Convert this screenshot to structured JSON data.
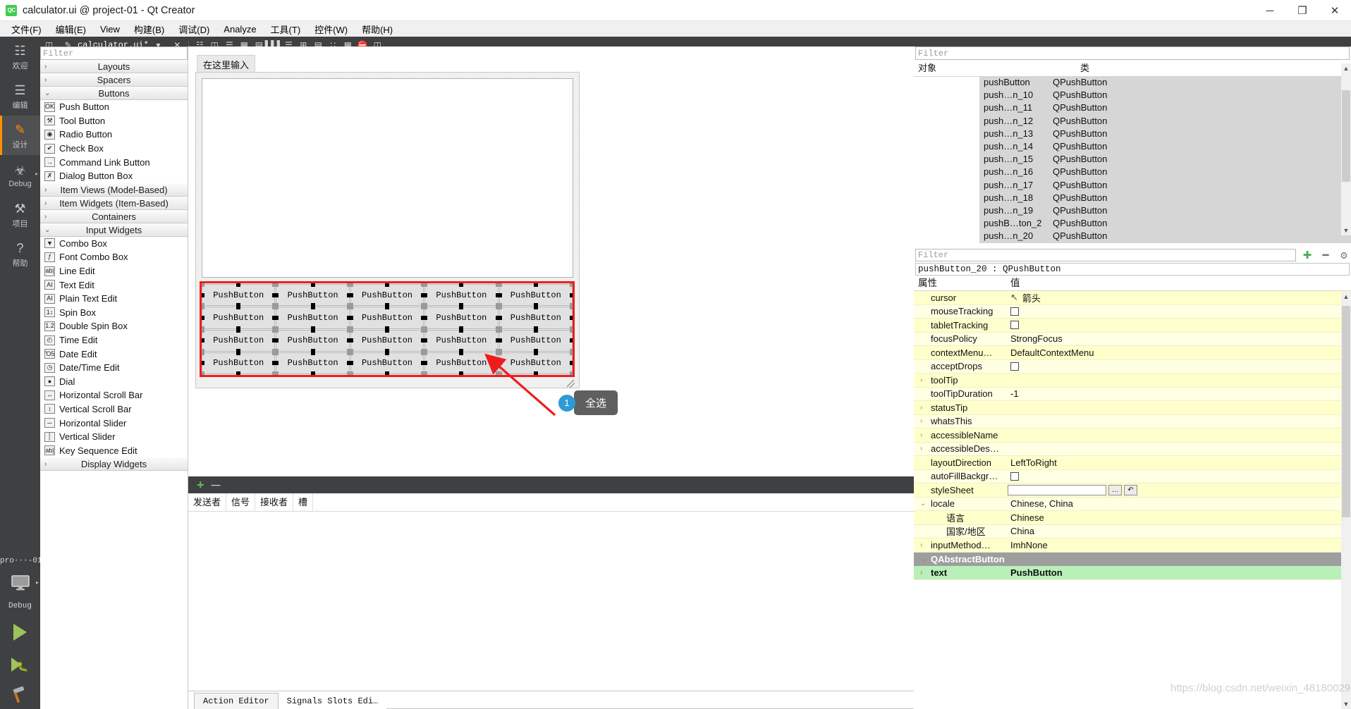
{
  "window": {
    "title": "calculator.ui @ project-01 - Qt Creator",
    "logo_text": "QC",
    "minimize": "─",
    "maximize": "❐",
    "close": "✕"
  },
  "menubar": {
    "items": [
      "文件(F)",
      "编辑(E)",
      "View",
      "构建(B)",
      "调试(D)",
      "Analyze",
      "工具(T)",
      "控件(W)",
      "帮助(H)"
    ]
  },
  "modebar": {
    "items": [
      {
        "label": "欢迎",
        "icon": "grid-icon",
        "glyph": "☷",
        "active": false
      },
      {
        "label": "编辑",
        "icon": "document-icon",
        "glyph": "☰",
        "active": false
      },
      {
        "label": "设计",
        "icon": "pencil-icon",
        "glyph": "✎",
        "active": true
      },
      {
        "label": "Debug",
        "icon": "bug-icon",
        "glyph": "☣",
        "active": false,
        "arrow": "▸"
      },
      {
        "label": "项目",
        "icon": "wrench-icon",
        "glyph": "⚒",
        "active": false
      },
      {
        "label": "帮助",
        "icon": "question-icon",
        "glyph": "?",
        "active": false
      }
    ],
    "bottom": {
      "project": "pro···-01",
      "kit_icon": "monitor-icon",
      "kit_label": "Debug",
      "run_icon": "run-icon",
      "debug_icon": "debug-run-icon",
      "build_icon": "hammer-icon"
    }
  },
  "edtoolbar": {
    "file_name": "calculator.ui*",
    "icons": [
      "split-icon",
      "edit-file-icon",
      "dropdown-icon",
      "close-file-icon",
      "adjust-size-icon",
      "lay-horizontally-icon",
      "lay-vertically-icon",
      "lay-grid-icon",
      "break-layout-icon",
      "lay-splitter-h-icon",
      "lay-splitter-v-icon",
      "lay-form-icon",
      "tab-order-icon",
      "buddy-icon",
      "signal-slot-icon",
      "preview-icon"
    ]
  },
  "widgetbox": {
    "filter_placeholder": "Filter",
    "categories": [
      {
        "name": "Layouts",
        "expanded": false,
        "items": []
      },
      {
        "name": "Spacers",
        "expanded": false,
        "items": []
      },
      {
        "name": "Buttons",
        "expanded": true,
        "items": [
          {
            "label": "Push Button",
            "icon": "push-button-icon",
            "glyph": "OK"
          },
          {
            "label": "Tool Button",
            "icon": "tool-button-icon",
            "glyph": "⚒"
          },
          {
            "label": "Radio Button",
            "icon": "radio-button-icon",
            "glyph": "◉"
          },
          {
            "label": "Check Box",
            "icon": "check-box-icon",
            "glyph": "✔"
          },
          {
            "label": "Command Link Button",
            "icon": "command-link-icon",
            "glyph": "→"
          },
          {
            "label": "Dialog Button Box",
            "icon": "dialog-button-box-icon",
            "glyph": "✗"
          }
        ]
      },
      {
        "name": "Item Views (Model-Based)",
        "expanded": false,
        "items": []
      },
      {
        "name": "Item Widgets (Item-Based)",
        "expanded": false,
        "items": []
      },
      {
        "name": "Containers",
        "expanded": false,
        "items": []
      },
      {
        "name": "Input Widgets",
        "expanded": true,
        "items": [
          {
            "label": "Combo Box",
            "icon": "combo-box-icon",
            "glyph": "▼"
          },
          {
            "label": "Font Combo Box",
            "icon": "font-combo-box-icon",
            "glyph": "ƒ"
          },
          {
            "label": "Line Edit",
            "icon": "line-edit-icon",
            "glyph": "ab|"
          },
          {
            "label": "Text Edit",
            "icon": "text-edit-icon",
            "glyph": "AI"
          },
          {
            "label": "Plain Text Edit",
            "icon": "plain-text-edit-icon",
            "glyph": "AI"
          },
          {
            "label": "Spin Box",
            "icon": "spin-box-icon",
            "glyph": "1↕"
          },
          {
            "label": "Double Spin Box",
            "icon": "double-spin-box-icon",
            "glyph": "1.2"
          },
          {
            "label": "Time Edit",
            "icon": "time-edit-icon",
            "glyph": "◴"
          },
          {
            "label": "Date Edit",
            "icon": "date-edit-icon",
            "glyph": "Ὄ5"
          },
          {
            "label": "Date/Time Edit",
            "icon": "date-time-edit-icon",
            "glyph": "◷"
          },
          {
            "label": "Dial",
            "icon": "dial-icon",
            "glyph": "●"
          },
          {
            "label": "Horizontal Scroll Bar",
            "icon": "horizontal-scroll-bar-icon",
            "glyph": "↔"
          },
          {
            "label": "Vertical Scroll Bar",
            "icon": "vertical-scroll-bar-icon",
            "glyph": "↕"
          },
          {
            "label": "Horizontal Slider",
            "icon": "horizontal-slider-icon",
            "glyph": "─"
          },
          {
            "label": "Vertical Slider",
            "icon": "vertical-slider-icon",
            "glyph": "│"
          },
          {
            "label": "Key Sequence Edit",
            "icon": "key-sequence-edit-icon",
            "glyph": "ab|"
          }
        ]
      },
      {
        "name": "Display Widgets",
        "expanded": false,
        "items": []
      }
    ],
    "chevron_collapsed": "›",
    "chevron_expanded": "⌄"
  },
  "designer": {
    "menu_placeholder": "在这里输入",
    "button_label": "PushButton",
    "grid_rows": 4,
    "grid_cols": 5,
    "selection_color": "#ee1d1d",
    "annotation": {
      "badge": "1",
      "text": "全选",
      "badge_color": "#2e9bd6",
      "box_color": "#5f5f5f",
      "arrow_color": "#ee1d1d"
    }
  },
  "bottom_panel": {
    "add_label": "+",
    "remove_label": "─",
    "headers": [
      "发送者",
      "信号",
      "接收者",
      "槽"
    ],
    "tabs": [
      {
        "label": "Action Editor",
        "active": true
      },
      {
        "label": "Signals  Slots Edi…",
        "active": false
      }
    ]
  },
  "object_inspector": {
    "filter_placeholder": "Filter",
    "columns": [
      "对象",
      "类"
    ],
    "rows": [
      {
        "object": "pushButton",
        "class": "QPushButton"
      },
      {
        "object": "push…n_10",
        "class": "QPushButton"
      },
      {
        "object": "push…n_11",
        "class": "QPushButton"
      },
      {
        "object": "push…n_12",
        "class": "QPushButton"
      },
      {
        "object": "push…n_13",
        "class": "QPushButton"
      },
      {
        "object": "push…n_14",
        "class": "QPushButton"
      },
      {
        "object": "push…n_15",
        "class": "QPushButton"
      },
      {
        "object": "push…n_16",
        "class": "QPushButton"
      },
      {
        "object": "push…n_17",
        "class": "QPushButton"
      },
      {
        "object": "push…n_18",
        "class": "QPushButton"
      },
      {
        "object": "push…n_19",
        "class": "QPushButton"
      },
      {
        "object": "pushB…ton_2",
        "class": "QPushButton"
      },
      {
        "object": "push…n_20",
        "class": "QPushButton"
      }
    ]
  },
  "property_editor": {
    "filter_placeholder": "Filter",
    "add_icon": "plus-icon",
    "remove_icon": "minus-icon",
    "config_icon": "wrench-icon",
    "object_line": "pushButton_20 : QPushButton",
    "columns": [
      "属性",
      "值"
    ],
    "rows": [
      {
        "key": "cursor",
        "value": "箭头",
        "type": "cursor",
        "expandable": false
      },
      {
        "key": "mouseTracking",
        "value": "",
        "type": "checkbox",
        "expandable": false
      },
      {
        "key": "tabletTracking",
        "value": "",
        "type": "checkbox",
        "expandable": false
      },
      {
        "key": "focusPolicy",
        "value": "StrongFocus",
        "type": "text",
        "expandable": false
      },
      {
        "key": "contextMenu…",
        "value": "DefaultContextMenu",
        "type": "text",
        "expandable": false
      },
      {
        "key": "acceptDrops",
        "value": "",
        "type": "checkbox",
        "expandable": false
      },
      {
        "key": "toolTip",
        "value": "",
        "type": "text",
        "expandable": true
      },
      {
        "key": "toolTipDuration",
        "value": "-1",
        "type": "text",
        "expandable": false
      },
      {
        "key": "statusTip",
        "value": "",
        "type": "text",
        "expandable": true
      },
      {
        "key": "whatsThis",
        "value": "",
        "type": "text",
        "expandable": true
      },
      {
        "key": "accessibleName",
        "value": "",
        "type": "text",
        "expandable": true
      },
      {
        "key": "accessibleDes…",
        "value": "",
        "type": "text",
        "expandable": true
      },
      {
        "key": "layoutDirection",
        "value": "LeftToRight",
        "type": "text",
        "expandable": false
      },
      {
        "key": "autoFillBackgr…",
        "value": "",
        "type": "checkbox",
        "expandable": false
      },
      {
        "key": "styleSheet",
        "value": "",
        "type": "stylesheet",
        "expandable": false
      },
      {
        "key": "locale",
        "value": "Chinese, China",
        "type": "text",
        "expandable": true,
        "expanded": true
      },
      {
        "key": "语言",
        "value": "Chinese",
        "type": "text",
        "indent": 2
      },
      {
        "key": "国家/地区",
        "value": "China",
        "type": "text",
        "indent": 2
      },
      {
        "key": "inputMethod…",
        "value": "ImhNone",
        "type": "text",
        "expandable": true
      },
      {
        "key": "QAbstractButton",
        "value": "",
        "type": "group",
        "expanded": true
      },
      {
        "key": "text",
        "value": "PushButton",
        "type": "text",
        "expandable": true,
        "highlight": "green"
      }
    ]
  },
  "watermark": "https://blog.csdn.net/weixin_48180029"
}
